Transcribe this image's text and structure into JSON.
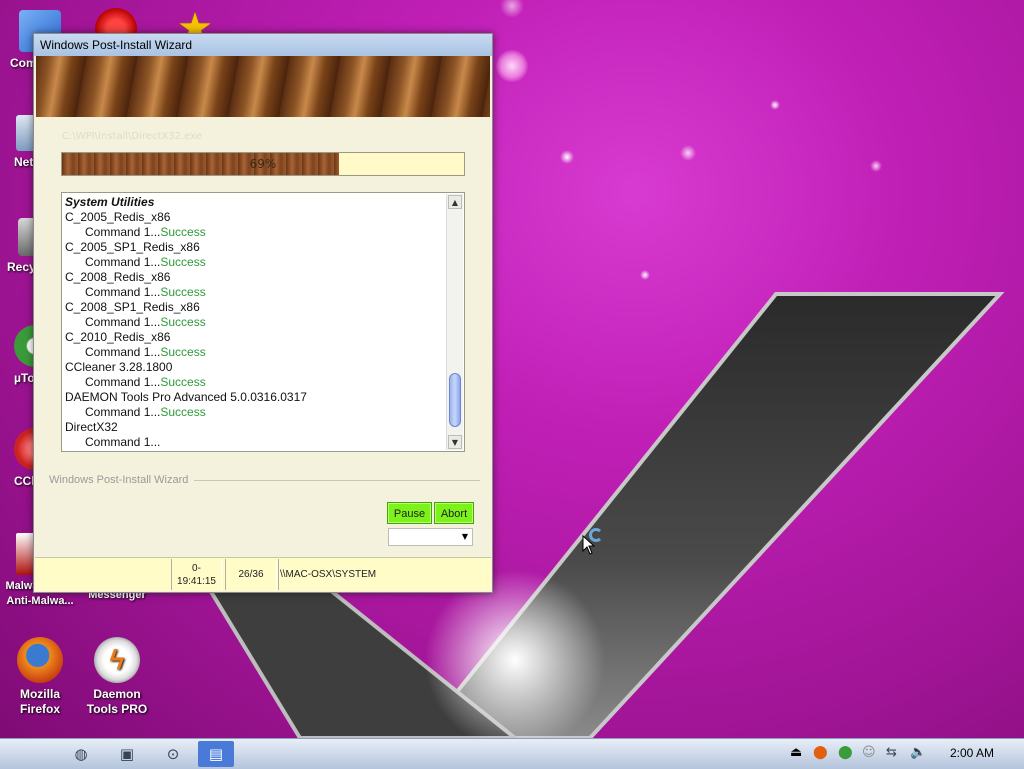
{
  "desktop": {
    "icons": [
      {
        "label": "Com",
        "glyph": "finder-icon",
        "color": "#3a7be0"
      },
      {
        "label": "",
        "glyph": "opera-icon",
        "color": "#e01616"
      },
      {
        "label": "",
        "glyph": "star-icon",
        "color": "#f5c400"
      },
      {
        "label": "Net",
        "glyph": "network-icon",
        "color": "#6a8fb8"
      },
      {
        "label": "Recy",
        "glyph": "trash-icon",
        "color": "#7a7a7a"
      },
      {
        "label": "µTo",
        "glyph": "utorrent-icon",
        "color": "#3b9b3b"
      },
      {
        "label": "CCl",
        "glyph": "ccleaner-icon",
        "color": "#d33a2a"
      },
      {
        "label": "Malwarebyt... Anti-Malwa...",
        "glyph": "malwarebytes-icon",
        "color": "#b01010"
      },
      {
        "label": "Yahoo! Messenger",
        "glyph": "yahoo-icon",
        "color": "#6b2c91"
      },
      {
        "label": "Mozilla Firefox",
        "glyph": "firefox-icon",
        "color": "#e66a1c"
      },
      {
        "label": "Daemon Tools PRO",
        "glyph": "daemon-tools-icon",
        "color": "#f07a10"
      }
    ]
  },
  "window": {
    "title": "Windows Post-Install Wizard",
    "path": "C:\\WPI\\Install\\DirectX32.exe",
    "progress": {
      "value": 0.69,
      "label": "69%"
    },
    "log": [
      {
        "type": "cat",
        "text": "System Utilities"
      },
      {
        "type": "item",
        "text": "C_2005_Redis_x86"
      },
      {
        "type": "cmd",
        "text": "Command 1...",
        "status": "Success"
      },
      {
        "type": "item",
        "text": "C_2005_SP1_Redis_x86"
      },
      {
        "type": "cmd",
        "text": "Command 1...",
        "status": "Success"
      },
      {
        "type": "item",
        "text": "C_2008_Redis_x86"
      },
      {
        "type": "cmd",
        "text": "Command 1...",
        "status": "Success"
      },
      {
        "type": "item",
        "text": "C_2008_SP1_Redis_x86"
      },
      {
        "type": "cmd",
        "text": "Command 1...",
        "status": "Success"
      },
      {
        "type": "item",
        "text": "C_2010_Redis_x86"
      },
      {
        "type": "cmd",
        "text": "Command 1...",
        "status": "Success"
      },
      {
        "type": "item",
        "text": "CCleaner 3.28.1800"
      },
      {
        "type": "cmd",
        "text": "Command 1...",
        "status": "Success"
      },
      {
        "type": "item",
        "text": "DAEMON Tools Pro Advanced 5.0.0316.0317"
      },
      {
        "type": "cmd",
        "text": "Command 1...",
        "status": "Success"
      },
      {
        "type": "item",
        "text": "DirectX32"
      },
      {
        "type": "cmd",
        "text": "Command 1...",
        "status": ""
      }
    ],
    "group_label": "Windows Post-Install Wizard",
    "buttons": {
      "pause": "Pause",
      "abort": "Abort"
    },
    "combo_value": "",
    "status": {
      "elapsed_line1": "0-",
      "elapsed_line2": "19:41:15",
      "count": "26/36",
      "machine": "\\\\MAC-OSX\\SYSTEM"
    }
  },
  "taskbar": {
    "clock": "2:00 AM"
  },
  "colors": {
    "desktop": "#c01fb6",
    "button_green": "#7df21a",
    "success": "#2e9a3a"
  }
}
